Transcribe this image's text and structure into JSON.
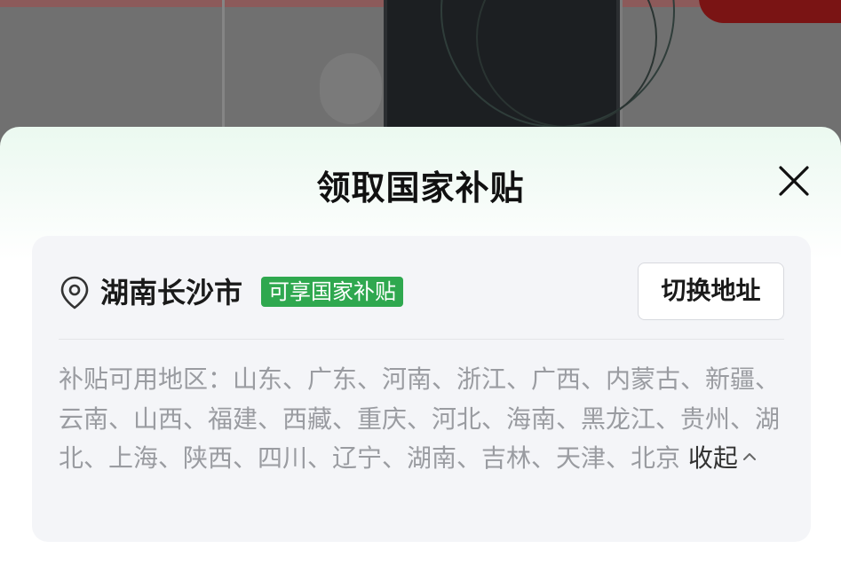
{
  "sheet": {
    "title": "领取国家补贴",
    "close_icon": "close-icon"
  },
  "location": {
    "icon": "location-pin-icon",
    "city": "湖南长沙市",
    "badge": "可享国家补贴",
    "switch_label": "切换地址"
  },
  "regions": {
    "text": "补贴可用地区：山东、广东、河南、浙江、广西、内蒙古、新疆、云南、山西、福建、西藏、重庆、河北、海南、黑龙江、贵州、湖北、上海、陕西、四川、辽宁、湖南、吉林、天津、北京",
    "collapse_label": "收起",
    "collapse_icon": "chevron-up-icon"
  },
  "colors": {
    "badge_green": "#2fa84f",
    "card_bg": "#f4f5f8",
    "muted_text": "#9a9ca1"
  }
}
